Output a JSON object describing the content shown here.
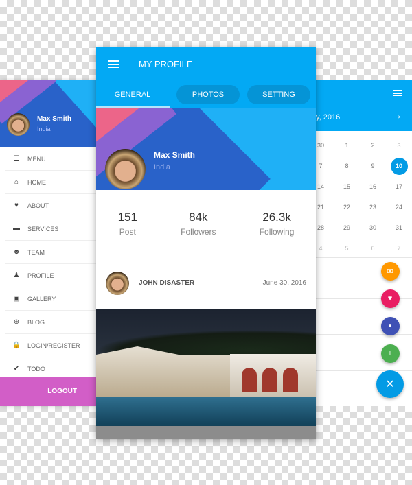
{
  "left_drawer": {
    "user_name": "Max Smith",
    "user_location": "India",
    "items": [
      {
        "label": "MENU",
        "icon": "menu-icon"
      },
      {
        "label": "HOME",
        "icon": "home-icon"
      },
      {
        "label": "ABOUT",
        "icon": "heart-icon"
      },
      {
        "label": "SERVICES",
        "icon": "briefcase-icon"
      },
      {
        "label": "TEAM",
        "icon": "team-icon"
      },
      {
        "label": "PROFILE",
        "icon": "user-icon"
      },
      {
        "label": "GALLERY",
        "icon": "image-icon"
      },
      {
        "label": "BLOG",
        "icon": "lifebuoy-icon"
      },
      {
        "label": "LOGIN/REGISTER",
        "icon": "lock-icon"
      },
      {
        "label": "TODO",
        "icon": "check-icon"
      }
    ],
    "logout": "LOGOUT",
    "accent": "#d25ec7"
  },
  "profile": {
    "title": "MY PROFILE",
    "tabs": [
      "GENERAL",
      "PHOTOS",
      "SETTING"
    ],
    "active_tab": "GENERAL",
    "user_name": "Max Smith",
    "user_location": "India",
    "stats": [
      {
        "value": "151",
        "label": "Post"
      },
      {
        "value": "84k",
        "label": "Followers"
      },
      {
        "value": "26.3k",
        "label": "Following"
      }
    ],
    "post": {
      "author": "JOHN DISASTER",
      "date": "June 30, 2016"
    },
    "accent": "#03a9f4"
  },
  "calendar": {
    "month_label": "y, 2016",
    "days": [
      [
        "30",
        "1",
        "2",
        "3"
      ],
      [
        "7",
        "8",
        "9",
        "10"
      ],
      [
        "14",
        "15",
        "16",
        "17"
      ],
      [
        "21",
        "22",
        "23",
        "24"
      ],
      [
        "28",
        "29",
        "30",
        "31"
      ],
      [
        "4",
        "5",
        "6",
        "7"
      ]
    ],
    "selected": "10",
    "fabs": [
      {
        "icon": "mail-icon",
        "color": "#ff9800"
      },
      {
        "icon": "heart-icon",
        "color": "#e91e63"
      },
      {
        "icon": "save-icon",
        "color": "#3f51b5"
      },
      {
        "icon": "add-icon",
        "color": "#4caf50"
      },
      {
        "icon": "close-icon",
        "color": "#039be5"
      }
    ]
  }
}
